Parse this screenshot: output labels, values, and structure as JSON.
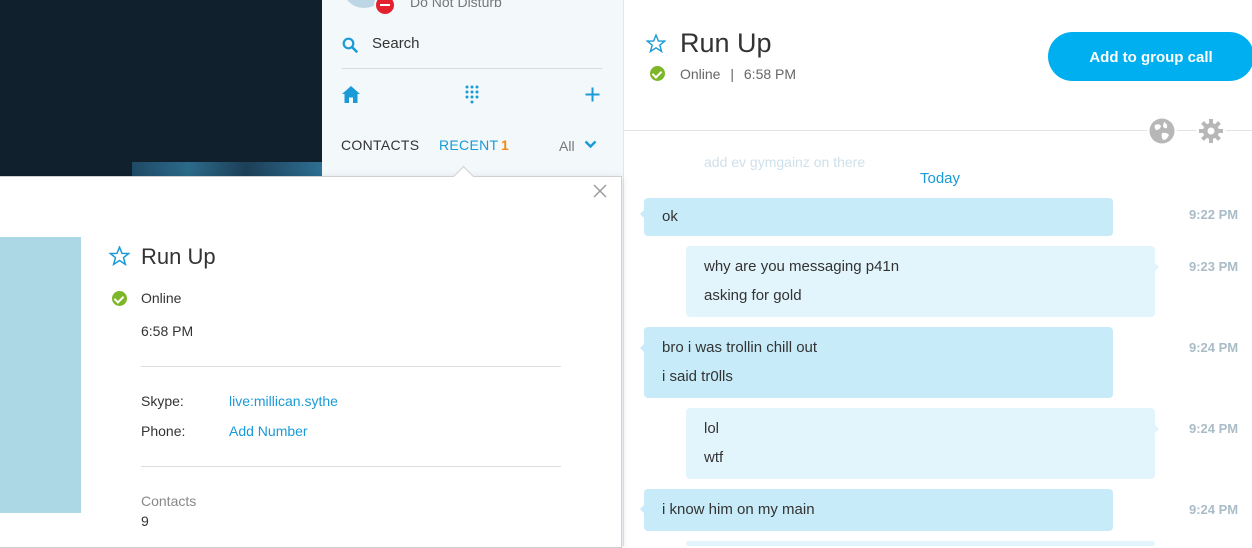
{
  "sidebar": {
    "status_text": "Do Not Disturb",
    "search_label": "Search",
    "tabs": {
      "contacts": "CONTACTS",
      "recent": "RECENT",
      "recent_count": "1"
    },
    "filter": "All"
  },
  "chat": {
    "title": "Run Up",
    "status": "Online",
    "status_separator": "|",
    "local_time": "6:58 PM",
    "add_group_label": "Add to group call",
    "faded_preview": "add ev gymgainz on there",
    "date_divider": "Today",
    "messages": [
      {
        "lines": [
          "ok"
        ],
        "time": "9:22 PM",
        "style": "dark"
      },
      {
        "lines": [
          "why are you messaging p41n",
          "asking for gold"
        ],
        "time": "9:23 PM",
        "style": "light"
      },
      {
        "lines": [
          "bro i was trollin chill out",
          "i said tr0lls"
        ],
        "time": "9:24 PM",
        "style": "dark"
      },
      {
        "lines": [
          "lol",
          "wtf"
        ],
        "time": "9:24 PM",
        "style": "light"
      },
      {
        "lines": [
          "i know him on my main"
        ],
        "time": "9:24 PM",
        "style": "dark"
      }
    ]
  },
  "profile": {
    "name": "Run Up",
    "status": "Online",
    "local_time": "6:58 PM",
    "skype_label": "Skype:",
    "skype_value": "live:millican.sythe",
    "phone_label": "Phone:",
    "phone_value": "Add Number",
    "contacts_label": "Contacts",
    "contacts_value": "9"
  },
  "colors": {
    "accent": "#00aff0",
    "link": "#1a9ad6",
    "online": "#7db628",
    "dnd": "#e2202e",
    "recent_count": "#f08a1c",
    "bubble_dark": "#c7ebf9",
    "bubble_light": "#e2f5fc"
  },
  "icons": [
    "search-icon",
    "home-icon",
    "dialpad-icon",
    "plus-icon",
    "chevron-down-icon",
    "star-icon",
    "globe-icon",
    "gear-icon",
    "close-icon"
  ]
}
